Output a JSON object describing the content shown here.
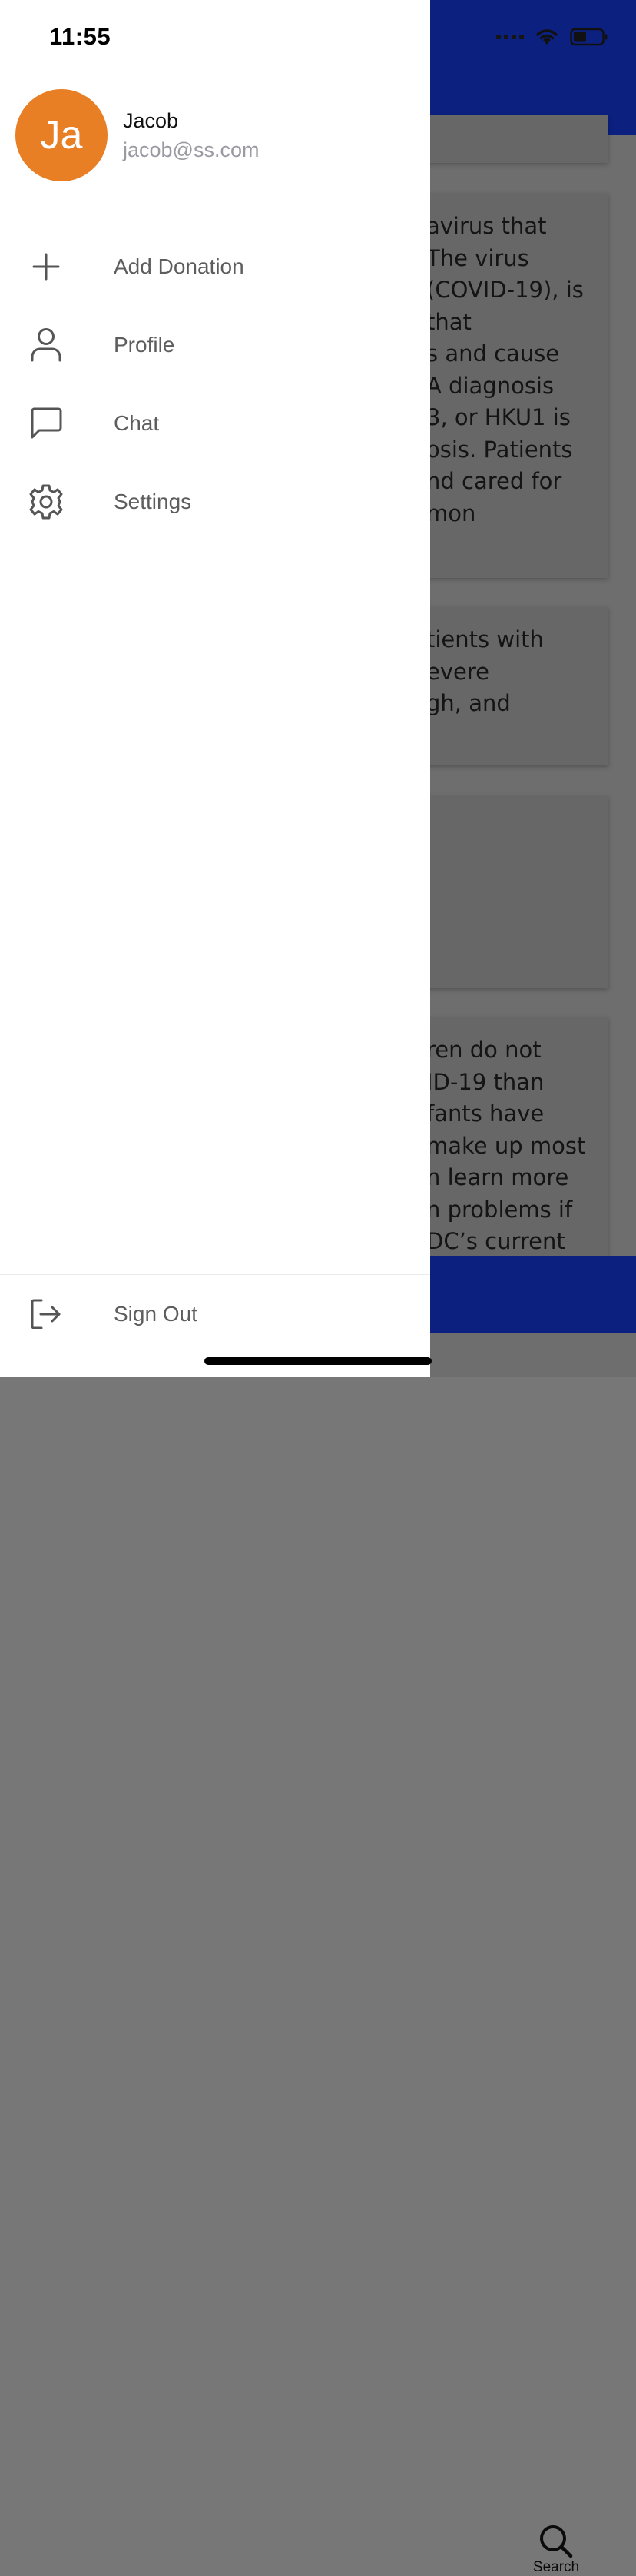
{
  "status_bar": {
    "time": "11:55"
  },
  "user": {
    "initials": "Ja",
    "name": "Jacob",
    "email": "jacob@ss.com",
    "avatar_color": "#e87f25"
  },
  "menu": {
    "items": [
      {
        "label": "Add Donation",
        "icon": "plus-icon"
      },
      {
        "label": "Profile",
        "icon": "person-icon"
      },
      {
        "label": "Chat",
        "icon": "chat-bubble-icon"
      },
      {
        "label": "Settings",
        "icon": "gear-icon"
      }
    ],
    "sign_out": {
      "label": "Sign Out",
      "icon": "sign-out-icon"
    }
  },
  "background": {
    "header_color": "#0c2080",
    "cards": [
      {
        "text": "avirus that\n The virus\n(COVID-19), is\n that\ns and cause\n A diagnosis\n3, or HKU1 is\nosis. Patients\nnd cared for\nmon"
      },
      {
        "text": "tients with\nevere\ngh, and"
      },
      {
        "text": ""
      },
      {
        "text": "ren do not\nID-19 than\nfants have\nmake up most\nn learn more\nn problems if\nDC’s current"
      }
    ],
    "tab_bar": {
      "search_label": "Search"
    }
  }
}
